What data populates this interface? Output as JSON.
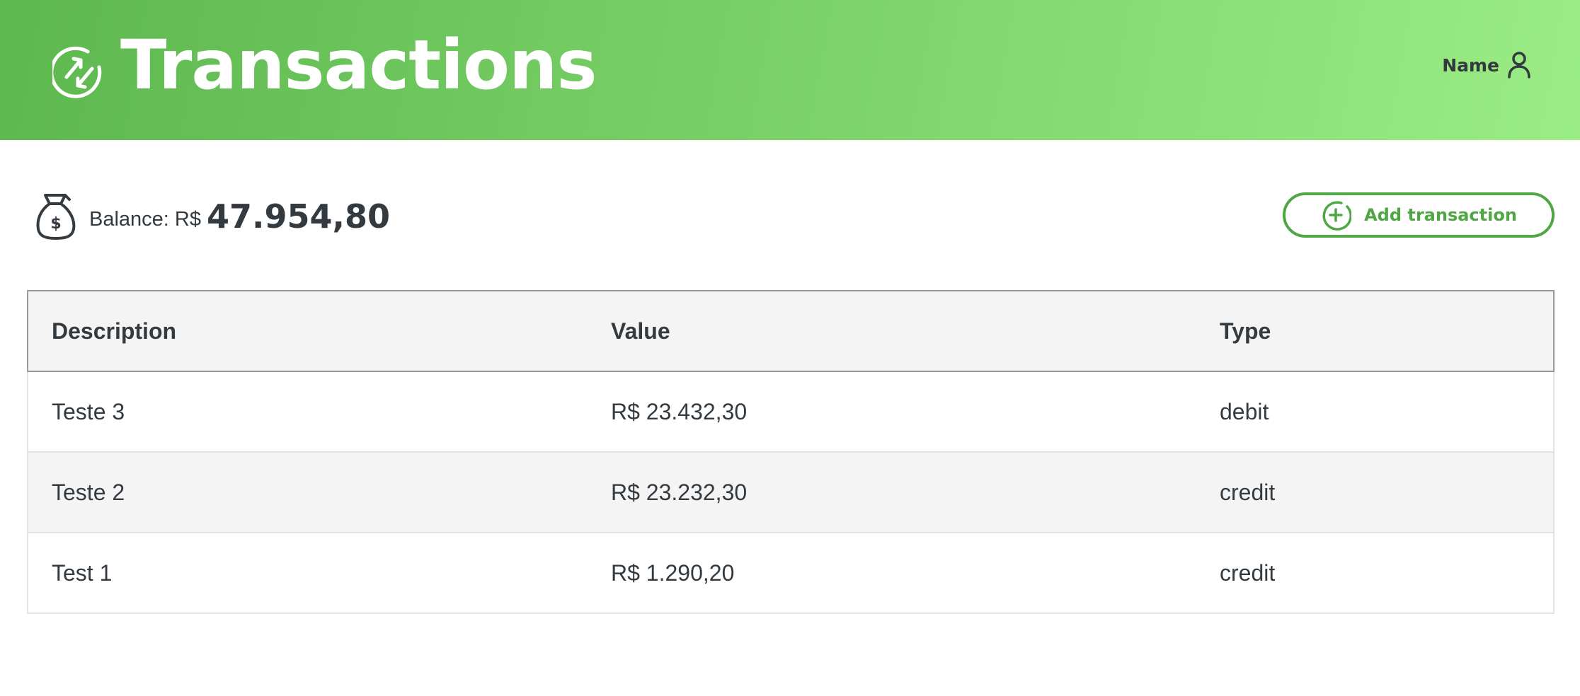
{
  "header": {
    "title": "Transactions",
    "logo_icon": "transfer-arrows-icon",
    "user_name": "Name",
    "user_icon": "user-icon"
  },
  "balance": {
    "icon": "money-bag-icon",
    "label": "Balance: R$",
    "amount": "47.954,80"
  },
  "actions": {
    "add_transaction_label": "Add transaction",
    "add_icon": "plus-circle-icon"
  },
  "table": {
    "columns": [
      "Description",
      "Value",
      "Type"
    ],
    "rows": [
      {
        "description": "Teste 3",
        "value": "R$ 23.432,30",
        "type": "debit"
      },
      {
        "description": "Teste 2",
        "value": "R$ 23.232,30",
        "type": "credit"
      },
      {
        "description": "Test 1",
        "value": "R$ 1.290,20",
        "type": "credit"
      }
    ]
  },
  "colors": {
    "header_gradient_start": "#5db84f",
    "header_gradient_end": "#9bec85",
    "accent": "#4ea743",
    "text": "#333a40"
  }
}
